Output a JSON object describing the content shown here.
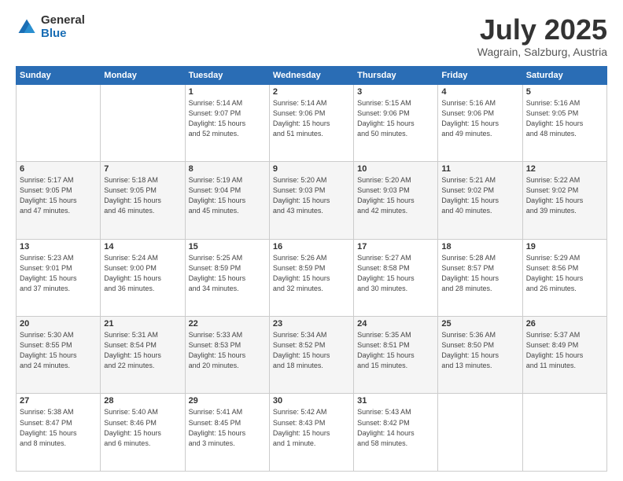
{
  "logo": {
    "general": "General",
    "blue": "Blue"
  },
  "header": {
    "month": "July 2025",
    "location": "Wagrain, Salzburg, Austria"
  },
  "weekdays": [
    "Sunday",
    "Monday",
    "Tuesday",
    "Wednesday",
    "Thursday",
    "Friday",
    "Saturday"
  ],
  "weeks": [
    [
      {
        "day": "",
        "info": ""
      },
      {
        "day": "",
        "info": ""
      },
      {
        "day": "1",
        "info": "Sunrise: 5:14 AM\nSunset: 9:07 PM\nDaylight: 15 hours\nand 52 minutes."
      },
      {
        "day": "2",
        "info": "Sunrise: 5:14 AM\nSunset: 9:06 PM\nDaylight: 15 hours\nand 51 minutes."
      },
      {
        "day": "3",
        "info": "Sunrise: 5:15 AM\nSunset: 9:06 PM\nDaylight: 15 hours\nand 50 minutes."
      },
      {
        "day": "4",
        "info": "Sunrise: 5:16 AM\nSunset: 9:06 PM\nDaylight: 15 hours\nand 49 minutes."
      },
      {
        "day": "5",
        "info": "Sunrise: 5:16 AM\nSunset: 9:05 PM\nDaylight: 15 hours\nand 48 minutes."
      }
    ],
    [
      {
        "day": "6",
        "info": "Sunrise: 5:17 AM\nSunset: 9:05 PM\nDaylight: 15 hours\nand 47 minutes."
      },
      {
        "day": "7",
        "info": "Sunrise: 5:18 AM\nSunset: 9:05 PM\nDaylight: 15 hours\nand 46 minutes."
      },
      {
        "day": "8",
        "info": "Sunrise: 5:19 AM\nSunset: 9:04 PM\nDaylight: 15 hours\nand 45 minutes."
      },
      {
        "day": "9",
        "info": "Sunrise: 5:20 AM\nSunset: 9:03 PM\nDaylight: 15 hours\nand 43 minutes."
      },
      {
        "day": "10",
        "info": "Sunrise: 5:20 AM\nSunset: 9:03 PM\nDaylight: 15 hours\nand 42 minutes."
      },
      {
        "day": "11",
        "info": "Sunrise: 5:21 AM\nSunset: 9:02 PM\nDaylight: 15 hours\nand 40 minutes."
      },
      {
        "day": "12",
        "info": "Sunrise: 5:22 AM\nSunset: 9:02 PM\nDaylight: 15 hours\nand 39 minutes."
      }
    ],
    [
      {
        "day": "13",
        "info": "Sunrise: 5:23 AM\nSunset: 9:01 PM\nDaylight: 15 hours\nand 37 minutes."
      },
      {
        "day": "14",
        "info": "Sunrise: 5:24 AM\nSunset: 9:00 PM\nDaylight: 15 hours\nand 36 minutes."
      },
      {
        "day": "15",
        "info": "Sunrise: 5:25 AM\nSunset: 8:59 PM\nDaylight: 15 hours\nand 34 minutes."
      },
      {
        "day": "16",
        "info": "Sunrise: 5:26 AM\nSunset: 8:59 PM\nDaylight: 15 hours\nand 32 minutes."
      },
      {
        "day": "17",
        "info": "Sunrise: 5:27 AM\nSunset: 8:58 PM\nDaylight: 15 hours\nand 30 minutes."
      },
      {
        "day": "18",
        "info": "Sunrise: 5:28 AM\nSunset: 8:57 PM\nDaylight: 15 hours\nand 28 minutes."
      },
      {
        "day": "19",
        "info": "Sunrise: 5:29 AM\nSunset: 8:56 PM\nDaylight: 15 hours\nand 26 minutes."
      }
    ],
    [
      {
        "day": "20",
        "info": "Sunrise: 5:30 AM\nSunset: 8:55 PM\nDaylight: 15 hours\nand 24 minutes."
      },
      {
        "day": "21",
        "info": "Sunrise: 5:31 AM\nSunset: 8:54 PM\nDaylight: 15 hours\nand 22 minutes."
      },
      {
        "day": "22",
        "info": "Sunrise: 5:33 AM\nSunset: 8:53 PM\nDaylight: 15 hours\nand 20 minutes."
      },
      {
        "day": "23",
        "info": "Sunrise: 5:34 AM\nSunset: 8:52 PM\nDaylight: 15 hours\nand 18 minutes."
      },
      {
        "day": "24",
        "info": "Sunrise: 5:35 AM\nSunset: 8:51 PM\nDaylight: 15 hours\nand 15 minutes."
      },
      {
        "day": "25",
        "info": "Sunrise: 5:36 AM\nSunset: 8:50 PM\nDaylight: 15 hours\nand 13 minutes."
      },
      {
        "day": "26",
        "info": "Sunrise: 5:37 AM\nSunset: 8:49 PM\nDaylight: 15 hours\nand 11 minutes."
      }
    ],
    [
      {
        "day": "27",
        "info": "Sunrise: 5:38 AM\nSunset: 8:47 PM\nDaylight: 15 hours\nand 8 minutes."
      },
      {
        "day": "28",
        "info": "Sunrise: 5:40 AM\nSunset: 8:46 PM\nDaylight: 15 hours\nand 6 minutes."
      },
      {
        "day": "29",
        "info": "Sunrise: 5:41 AM\nSunset: 8:45 PM\nDaylight: 15 hours\nand 3 minutes."
      },
      {
        "day": "30",
        "info": "Sunrise: 5:42 AM\nSunset: 8:43 PM\nDaylight: 15 hours\nand 1 minute."
      },
      {
        "day": "31",
        "info": "Sunrise: 5:43 AM\nSunset: 8:42 PM\nDaylight: 14 hours\nand 58 minutes."
      },
      {
        "day": "",
        "info": ""
      },
      {
        "day": "",
        "info": ""
      }
    ]
  ]
}
